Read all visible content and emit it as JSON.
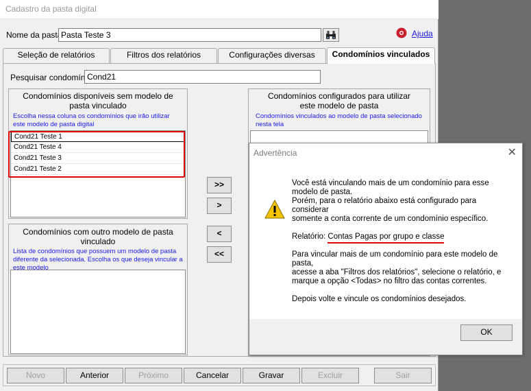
{
  "window": {
    "title": "Cadastro da pasta digital"
  },
  "header": {
    "folder_name_label": "Nome da pasta:",
    "folder_name_value": "Pasta Teste 3",
    "help_label": "Ajuda"
  },
  "tabs": [
    {
      "label": "Seleção de relatórios"
    },
    {
      "label": "Filtros dos relatórios"
    },
    {
      "label": "Configurações diversas"
    },
    {
      "label": "Condomínios vinculados"
    }
  ],
  "search": {
    "label": "Pesquisar condomínio:",
    "value": "Cond21"
  },
  "available": {
    "title": "Condomínios disponíveis sem modelo de pasta vinculado",
    "description": "Escolha nessa coluna os condomínios que irão utilizar este modelo de pasta digital",
    "items": [
      "Cond21 Teste 1",
      "Cond21 Teste 4",
      "Cond21 Teste 3",
      "Cond21 Teste 2"
    ]
  },
  "other_model": {
    "title": "Condomínios com outro modelo de pasta vinculado",
    "description": "Lista de condomínios que possuem um modelo de pasta diferente da selecionada. Escolha os que deseja vincular a este modelo"
  },
  "configured": {
    "title": "Condomínios configurados para utilizar este modelo de pasta",
    "description": "Condomínios vinculados ao modelo de pasta selecionado nesta tela"
  },
  "move_buttons": {
    "add_all": ">>",
    "add": ">",
    "remove": "<",
    "remove_all": "<<"
  },
  "footer": {
    "novo": "Novo",
    "anterior": "Anterior",
    "proximo": "Próximo",
    "cancelar": "Cancelar",
    "gravar": "Gravar",
    "excluir": "Excluir",
    "sair": "Sair"
  },
  "dialog": {
    "title": "Advertência",
    "lines1": [
      "Você está vinculando mais de um condomínio para esse",
      "modelo de pasta.",
      "Porém, para o relatório abaixo está configurado para",
      "considerar",
      "somente a conta corrente de um condomínio específico."
    ],
    "report_label": "Relatório:",
    "report_name": "Contas Pagas por grupo e classe",
    "lines2": [
      "Para vincular mais de um condomínio para este modelo de",
      "pasta,",
      "acesse a aba \"Filtros dos relatórios\", selecione o relatório, e",
      "marque a opção <Todas> no filtro das contas correntes."
    ],
    "line3": "Depois volte e vincule os condomínios desejados.",
    "ok": "OK"
  },
  "colors": {
    "highlight_red": "#e00000",
    "description_blue": "#1a1ae6",
    "dialog_bg": "#ffffff"
  },
  "icons": [
    "binoculars-icon",
    "help-icon",
    "warning-icon",
    "close-icon"
  ]
}
